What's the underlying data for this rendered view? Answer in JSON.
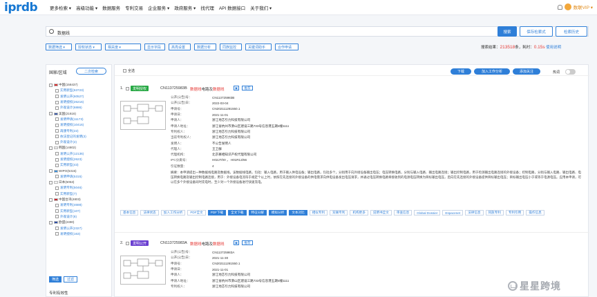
{
  "header": {
    "logo": "iprdb",
    "nav": [
      "更多检索 ▾",
      "高级功能 ▾",
      "数据服务",
      "专利交易",
      "企业服务 ▾",
      "政府服务 ▾",
      "找代理",
      "API 数据接口",
      "关于我们 ▾"
    ],
    "user": "数联VIP ▾"
  },
  "search": {
    "query": "数据线",
    "search_label": "搜索",
    "save_label": "保存检索式",
    "history_label": "检索历史"
  },
  "filters": [
    "数据筛选 ▾",
    "授权状态 ▾",
    "相关度 ▾",
    "显示字段",
    "高亮设置",
    "数据分析",
    "同族监控",
    "关键词助手",
    "合作申请"
  ],
  "stats": {
    "prefix": "搜索结果：",
    "count": "213518",
    "mid": "条，耗时：",
    "time": "0.15s",
    "link": "使用说明"
  },
  "sidebar": {
    "title": "国家/区域",
    "btn": "二次检索",
    "tree": [
      {
        "label": "中国(158437)",
        "level": 0,
        "flag": "cn"
      },
      {
        "label": "实用新型(63723)",
        "level": 1
      },
      {
        "label": "发明公开(60527)",
        "level": 1
      },
      {
        "label": "发明授权(26216)",
        "level": 1
      },
      {
        "label": "外观设计(6886)",
        "level": 1
      },
      {
        "label": "美国(21616)",
        "level": 0,
        "flag": "us"
      },
      {
        "label": "发明申请(11173)",
        "level": 1
      },
      {
        "label": "发明授权(10416)",
        "level": 1
      },
      {
        "label": "再颁专利(22)",
        "level": 1
      },
      {
        "label": "依法登记的发明(3)",
        "level": 1
      },
      {
        "label": "外观设计(2)",
        "level": 1
      },
      {
        "label": "韩国(14802)",
        "level": 0,
        "flag": "kr"
      },
      {
        "label": "发明公开(12136)",
        "level": 1
      },
      {
        "label": "发明授权(2623)",
        "level": 1
      },
      {
        "label": "实用新型(43)",
        "level": 1
      },
      {
        "label": "WIPO(5315)",
        "level": 0,
        "flag": "wo"
      },
      {
        "label": "发明申请(5315)",
        "level": 1
      },
      {
        "label": "日本(5053)",
        "level": 0,
        "flag": "jp"
      },
      {
        "label": "发明专利(5046)",
        "level": 1
      },
      {
        "label": "实用新型(7)",
        "level": 1
      },
      {
        "label": "中国台湾(4803)",
        "level": 0,
        "flag": "tw"
      },
      {
        "label": "发明专利(4688)",
        "level": 1
      },
      {
        "label": "实用新型(107)",
        "level": 1
      },
      {
        "label": "外观设计(8)",
        "level": 1
      },
      {
        "label": "欧盟(2490)",
        "level": 0,
        "flag": "eu"
      },
      {
        "label": "发明公开(2327)",
        "level": 1
      },
      {
        "label": "发明授权(163)",
        "level": 1
      }
    ],
    "apply": "筛选",
    "filter": "过滤",
    "footer": "专利有效性"
  },
  "toolbar": {
    "select_all": "全选",
    "download": "下载",
    "add_analysis": "加入工作分析",
    "add_follow": "添加关注",
    "hot": "热词"
  },
  "results": [
    {
      "index": "1.",
      "tag": "发明授权",
      "tag_color": "#27a844",
      "number": "CN113725983B",
      "title_pre": "",
      "title_hl": "数据线",
      "title_mid": "电路及",
      "title_hl2": "数据线",
      "mini1": "▣",
      "mini2": "推荐",
      "fields": [
        [
          "公开(公告)号：",
          "CN113725983B"
        ],
        [
          "公开(公告)日：",
          "2022-03-04"
        ],
        [
          "申请号：",
          "CN202111281550.1"
        ],
        [
          "申请日：",
          "2021-11-01"
        ],
        [
          "申请人：",
          "浙江地芯引力科技有限公司"
        ],
        [
          "申请人地址：",
          "浙江省杭州市萧山区建设三路733号信息港五期4幢1111"
        ],
        [
          "专利权人：",
          "浙江地芯引力科技有限公司"
        ],
        [
          "当前专利权人：",
          "浙江地芯引力科技有限公司"
        ],
        [
          "发明人：",
          "不公告发明人"
        ],
        [
          "代理人：",
          "王卫群"
        ],
        [
          "代理机构：",
          "北京慕相知识产权代理有限公司"
        ],
        [
          "IPC分类号：",
          "H02J7/00 ， H01R13/66"
        ],
        [
          "引证数量：",
          "4"
        ]
      ],
      "abstract_label": "摘要：",
      "abstract": "本申请提出一种数据线电路及数据线，该数据线电路，包括：输入电路，用于输入供电设备；输出电路，包括多个，分别用于向外接设备输出电压；电压转换电路，分别与输入电路、输出电路连接；输出控制电路，用于检测输出电路连接的外接设备；控制电路，分别与输入电路、输出电路、电压转换电路及输出控制电路连接，用于：外接设备电流符于规定个以上时，依照在先连接的外接设备的供电需求向供电设备发出电压请求，并通过电压转换电路将接收到的电源电压转换为目标输出电压，后向在先连接的外接设备提供目标输出电压；目标输出电压小于或等于电源电压。应用本申请，可以在多个外接设备同时充电时，至少对一个外接设备进行快速充电。",
      "links": [
        "基本信息",
        "法律状态",
        "加入工作分析",
        "PDF全文",
        "PDF下载",
        "全文下载",
        "特征分解",
        "模拟分析",
        "文本对比",
        "相似专利",
        "双联专利",
        "机构更多",
        "说明书全文",
        "审查信息",
        "Global Dossier",
        "Espacenet",
        "法律信息",
        "同族专利",
        "专利引用",
        "操作信息"
      ]
    },
    {
      "index": "2.",
      "tag": "发明公开",
      "tag_color": "#6a3fd0",
      "number": "CN113725983A",
      "title_pre": "",
      "title_hl": "数据线",
      "title_mid": "电路及",
      "title_hl2": "数据线",
      "mini1": "▣",
      "mini2": "推荐",
      "fields": [
        [
          "公开(公告)号：",
          "CN113725983A"
        ],
        [
          "公开(公告)日：",
          "2021-11-30"
        ],
        [
          "申请号：",
          "CN202111281550.1"
        ],
        [
          "申请日：",
          "2021-11-01"
        ],
        [
          "申请人：",
          "浙江地芯引力科技有限公司"
        ],
        [
          "申请人地址：",
          "浙江省杭州市萧山区建设三路733号信息港五期4幢1111"
        ],
        [
          "专利权人：",
          "浙江地芯引力科技有限公司"
        ]
      ]
    }
  ],
  "watermark": "星星跨境"
}
